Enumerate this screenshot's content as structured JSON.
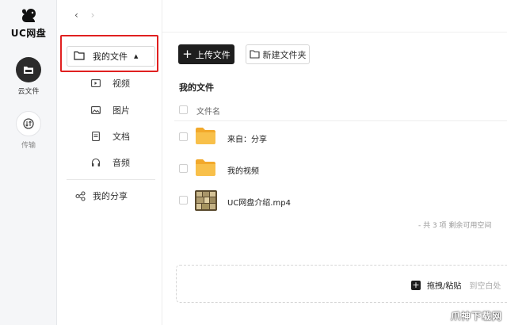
{
  "app": {
    "brand": "UC网盘"
  },
  "rail": {
    "items": [
      {
        "label": "云文件",
        "icon": "folder-icon",
        "active": true
      },
      {
        "label": "传输",
        "icon": "transfer-icon",
        "active": false
      }
    ]
  },
  "sidebar": {
    "mine": {
      "label": "我的文件",
      "icon": "folder-icon",
      "caret": "▲"
    },
    "items": [
      {
        "label": "视频",
        "icon": "video-icon"
      },
      {
        "label": "图片",
        "icon": "image-icon"
      },
      {
        "label": "文档",
        "icon": "document-icon"
      },
      {
        "label": "音频",
        "icon": "audio-icon"
      }
    ],
    "share": {
      "label": "我的分享",
      "icon": "share-icon"
    }
  },
  "toolbar": {
    "back": "‹",
    "forward": "›",
    "upload_plus": "+",
    "upload_label": "上传文件",
    "new_folder_label": "新建文件夹"
  },
  "main": {
    "title": "我的文件",
    "column_header": "文件名",
    "files": [
      {
        "name": "来自：分享",
        "type": "folder",
        "icon": "folder-icon"
      },
      {
        "name": "我的视频",
        "type": "folder",
        "icon": "folder-icon"
      },
      {
        "name": "UC网盘介绍.mp4",
        "type": "video",
        "icon": "video-thumbnail"
      }
    ],
    "summary": "- 共 3 项 剩余可用空间",
    "drop_main": "拖拽/粘贴",
    "drop_sub": "到空白处",
    "drop_plus": "+"
  },
  "watermark": "爪神下载网",
  "colors": {
    "accent_dark": "#1e1e1e",
    "highlight_red": "#e02020",
    "folder_yellow": "#f6b73c"
  }
}
